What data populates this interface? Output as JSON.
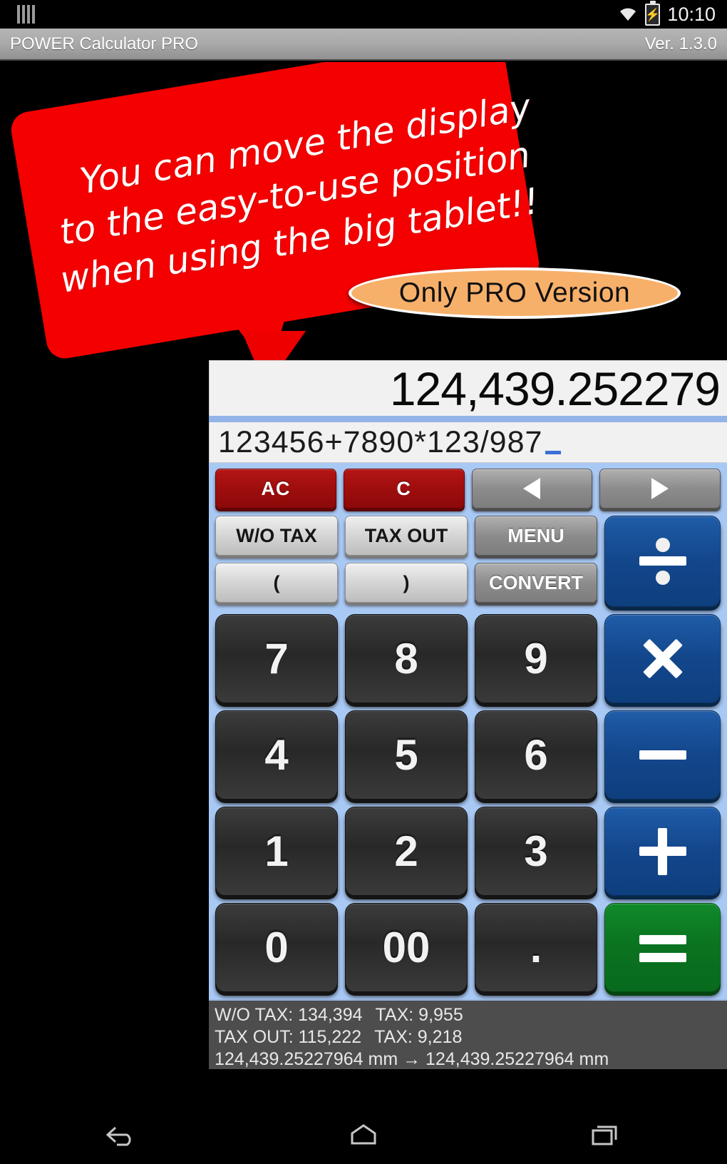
{
  "status_bar": {
    "sim_icon": "sim-card-icon",
    "wifi_icon": "wifi-icon",
    "battery_icon": "battery-charging-icon",
    "clock": "10:10"
  },
  "title_bar": {
    "app_title": "POWER Calculator PRO",
    "version": "Ver. 1.3.0"
  },
  "promo": {
    "banner_line1": "You can move the display",
    "banner_line2": "to the easy-to-use position",
    "banner_line3": "when using the big tablet!!",
    "pill_label": "Only PRO Version",
    "banner_color": "#f40000",
    "pill_color": "#f7b06a"
  },
  "display": {
    "result": "124,439.252279",
    "formula": "123456+7890*123/987",
    "cursor": "_"
  },
  "keypad": {
    "row1": [
      {
        "label": "AC",
        "name": "all-clear-button",
        "style": "red"
      },
      {
        "label": "C",
        "name": "clear-button",
        "style": "red"
      },
      {
        "label": "",
        "name": "cursor-left-button",
        "style": "gray-dark",
        "icon": "arrow-left-icon"
      },
      {
        "label": "",
        "name": "cursor-right-button",
        "style": "gray-dark",
        "icon": "arrow-right-icon"
      }
    ],
    "row2": [
      {
        "label": "W/O TAX",
        "name": "without-tax-button",
        "style": "gray-light"
      },
      {
        "label": "TAX OUT",
        "name": "tax-out-button",
        "style": "gray-light"
      },
      {
        "label": "MENU",
        "name": "menu-button",
        "style": "gray-dark"
      }
    ],
    "row3": [
      {
        "label": "(",
        "name": "open-paren-button",
        "style": "gray-light"
      },
      {
        "label": ")",
        "name": "close-paren-button",
        "style": "gray-light"
      },
      {
        "label": "CONVERT",
        "name": "convert-button",
        "style": "gray-dark"
      }
    ],
    "numbers": [
      [
        "7",
        "8",
        "9"
      ],
      [
        "4",
        "5",
        "6"
      ],
      [
        "1",
        "2",
        "3"
      ],
      [
        "0",
        "00",
        "."
      ]
    ],
    "operators": [
      {
        "symbol": "÷",
        "name": "divide-button",
        "icon": "divide-icon",
        "color": "#13478c"
      },
      {
        "symbol": "×",
        "name": "multiply-button",
        "icon": "multiply-icon",
        "color": "#13478c"
      },
      {
        "symbol": "−",
        "name": "minus-button",
        "icon": "minus-icon",
        "color": "#13478c"
      },
      {
        "symbol": "+",
        "name": "plus-button",
        "icon": "plus-icon",
        "color": "#13478c"
      },
      {
        "symbol": "=",
        "name": "equals-button",
        "icon": "equals-icon",
        "color": "#0a7320"
      }
    ]
  },
  "tax_panel": {
    "line1_a": "W/O TAX: 134,394",
    "line1_b": "TAX: 9,955",
    "line2_a": "TAX OUT: 115,222",
    "line2_b": "TAX: 9,218",
    "line3": "124,439.25227964 mm → 124,439.25227964 mm"
  },
  "nav_bar": {
    "back": "back-icon",
    "home": "home-icon",
    "recents": "recents-icon"
  }
}
